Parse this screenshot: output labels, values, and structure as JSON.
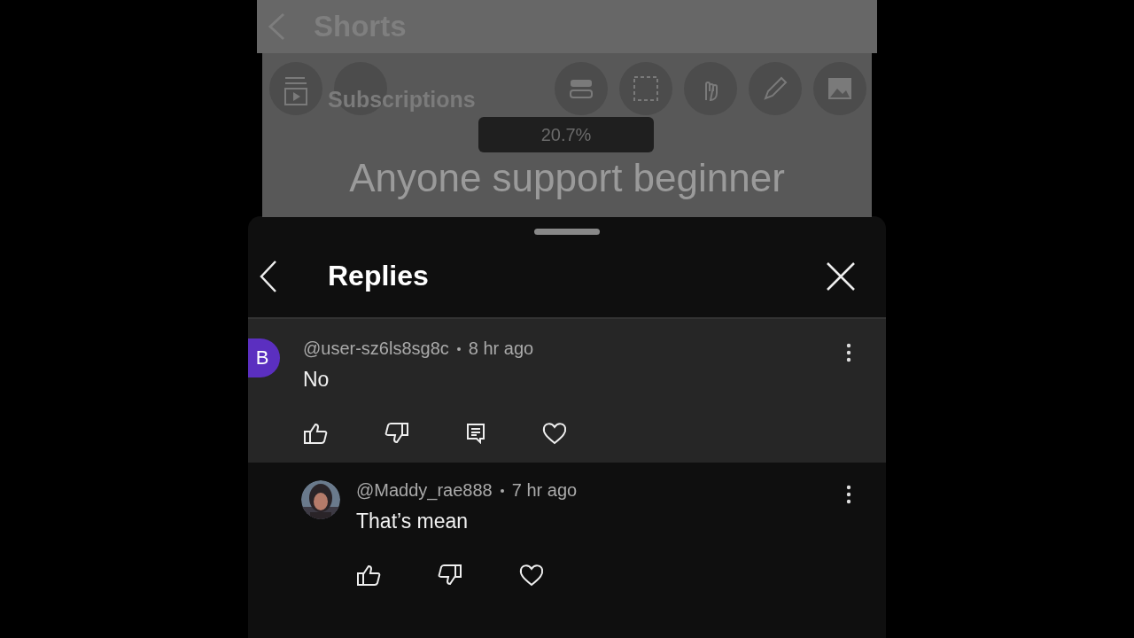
{
  "background_screen": {
    "header": {
      "title": "Shorts"
    },
    "subscriptions_label": "Subscriptions",
    "progress_overlay": {
      "text": "20.7%"
    },
    "post_title": "Anyone support beginner"
  },
  "replies_sheet": {
    "title": "Replies",
    "comments": [
      {
        "author": "@user-sz6ls8sg8c",
        "time": "8 hr ago",
        "text": "No",
        "avatar": {
          "kind": "letter",
          "letter": "B",
          "color": "#5b2fc0"
        },
        "highlighted": true,
        "indented": false,
        "actions": [
          {
            "kind": "like"
          },
          {
            "kind": "dislike"
          },
          {
            "kind": "reply"
          },
          {
            "kind": "heart"
          }
        ]
      },
      {
        "author": "@Maddy_rae888",
        "time": "7 hr ago",
        "text": "That’s mean",
        "avatar": {
          "kind": "picture"
        },
        "highlighted": false,
        "indented": true,
        "actions": [
          {
            "kind": "like"
          },
          {
            "kind": "dislike"
          },
          {
            "kind": "heart"
          }
        ]
      }
    ]
  }
}
